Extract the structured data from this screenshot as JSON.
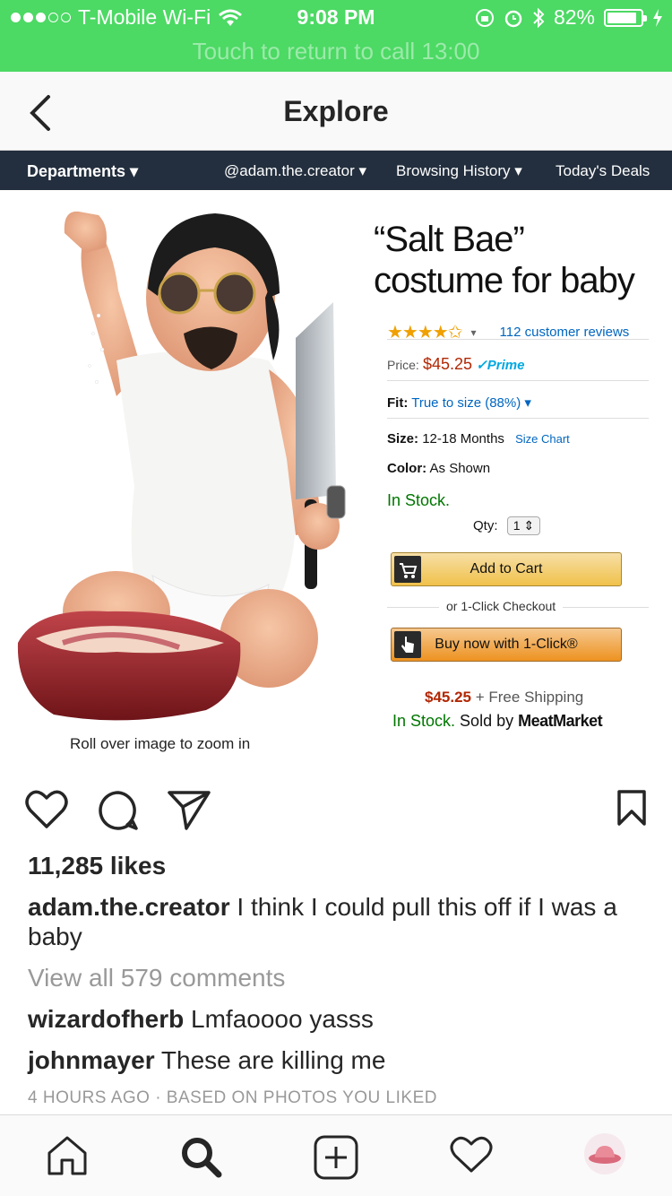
{
  "status_bar": {
    "carrier": "T-Mobile Wi-Fi",
    "time": "9:08 PM",
    "battery": "82%",
    "call_banner": "Touch to return to call 13:00"
  },
  "nav": {
    "title": "Explore",
    "back_icon": "chevron-left-icon"
  },
  "post_image": {
    "amazon_bar": {
      "departments": "Departments ▾",
      "account": "@adam.the.creator ▾",
      "history": "Browsing History ▾",
      "deals": "Today's Deals"
    },
    "product_title_line1": "“Salt Bae”",
    "product_title_line2": "costume for baby",
    "stars": "★★★★✩",
    "rating_caret": "▾",
    "reviews": "112 customer reviews",
    "price_label": "Price:",
    "price": "$45.25",
    "prime": "✓Prime",
    "fit_label": "Fit:",
    "fit_value": "True to size (88%) ▾",
    "size_label": "Size:",
    "size_value": "12-18 Months",
    "size_chart": "Size Chart",
    "color_label": "Color:",
    "color_value": "As Shown",
    "in_stock": "In Stock.",
    "qty_label": "Qty:",
    "qty_value": "1 ⇕",
    "add_to_cart": "Add to Cart",
    "one_click_checkout": "or 1-Click Checkout",
    "buy_now": "Buy now with 1-Click®",
    "shipping_price": "$45.25",
    "shipping_text": "+ Free Shipping",
    "stock_line_instock": "In Stock.",
    "stock_line_sold": "Sold by",
    "seller": "MeatMarket",
    "zoom_hint": "Roll over image to zoom in"
  },
  "post": {
    "likes": "11,285 likes",
    "author": "adam.the.creator",
    "caption": "I think I could pull this off if I was a baby",
    "view_all": "View all 579 comments",
    "comments": [
      {
        "user": "wizardofherb",
        "text": "Lmfaoooo yasss"
      },
      {
        "user": "johnmayer",
        "text": "These are killing me"
      }
    ],
    "time_ago": "4 HOURS AGO · BASED ON PHOTOS YOU LIKED"
  },
  "colors": {
    "status_green": "#4cd964",
    "amazon_nav": "#232f3e",
    "amazon_link": "#0066c0",
    "amazon_price": "#b12704"
  }
}
